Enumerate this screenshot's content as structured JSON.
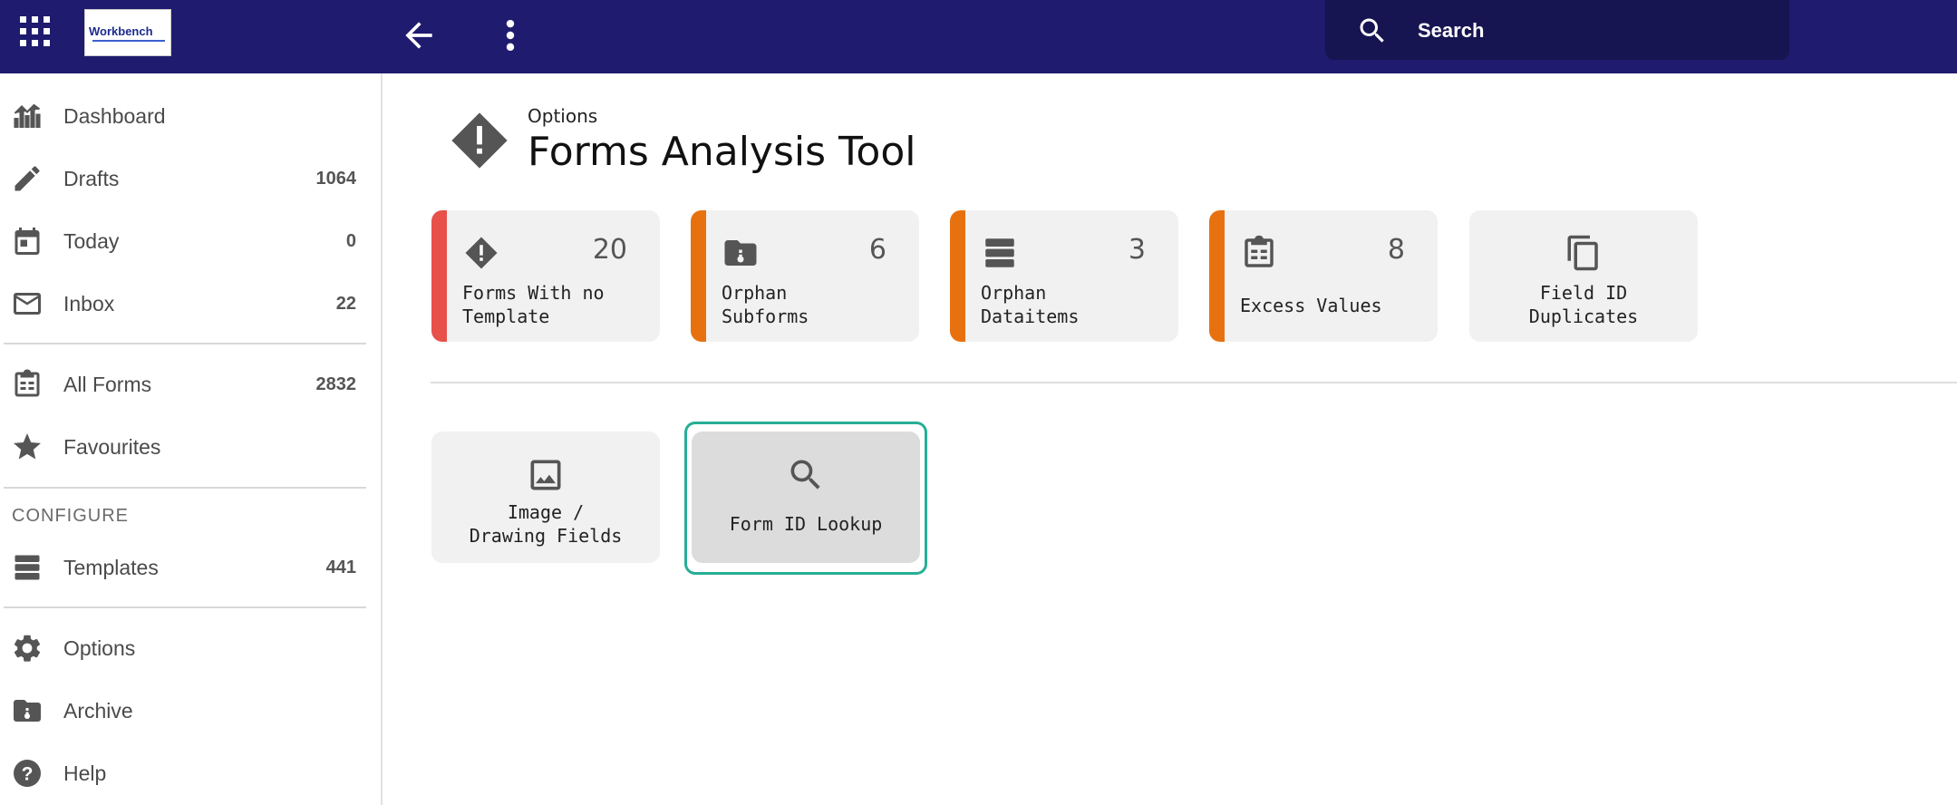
{
  "topbar": {
    "logo_text": "Workbench",
    "search_placeholder": "Search",
    "icons": {
      "apps": "apps-grid-icon",
      "back": "arrow-left-icon",
      "more": "more-vert-icon",
      "search": "search-icon"
    }
  },
  "sidebar": {
    "items": [
      {
        "label": "Dashboard",
        "count": "",
        "icon": "chart-icon"
      },
      {
        "label": "Drafts",
        "count": "1064",
        "icon": "pencil-icon"
      },
      {
        "label": "Today",
        "count": "0",
        "icon": "calendar-icon"
      },
      {
        "label": "Inbox",
        "count": "22",
        "icon": "inbox-icon"
      },
      {
        "label": "All Forms",
        "count": "2832",
        "icon": "clipboard-icon"
      },
      {
        "label": "Favourites",
        "count": "",
        "icon": "star-icon"
      },
      {
        "label": "Templates",
        "count": "441",
        "icon": "stack-icon"
      },
      {
        "label": "Options",
        "count": "",
        "icon": "gear-icon"
      },
      {
        "label": "Archive",
        "count": "",
        "icon": "archive-icon"
      },
      {
        "label": "Help",
        "count": "",
        "icon": "help-icon"
      }
    ],
    "section_configure": "CONFIGURE"
  },
  "main": {
    "breadcrumb": "Options",
    "title": "Forms Analysis Tool",
    "cards": [
      {
        "count": "20",
        "line1": "Forms With no",
        "line2": "Template",
        "icon": "warning-diamond-icon",
        "accent": "#e8504a"
      },
      {
        "count": "6",
        "line1": "Orphan",
        "line2": "Subforms",
        "icon": "folder-lock-icon",
        "accent": "#e8710f"
      },
      {
        "count": "3",
        "line1": "Orphan",
        "line2": "Dataitems",
        "icon": "database-icon",
        "accent": "#e8710f"
      },
      {
        "count": "8",
        "line1": "Excess Values",
        "line2": "",
        "icon": "clipboard-list-icon",
        "accent": "#e8710f"
      },
      {
        "count": "",
        "line1": "Field ID",
        "line2": "Duplicates",
        "icon": "copy-icon",
        "accent": ""
      }
    ],
    "tools": [
      {
        "line1": "Image /",
        "line2": "Drawing Fields",
        "icon": "image-icon"
      },
      {
        "line1": "Form ID Lookup",
        "line2": "",
        "icon": "search-icon"
      }
    ]
  },
  "colors": {
    "topbar": "#1f1b6e",
    "focus": "#27ae96",
    "red_accent": "#e8504a",
    "orange_accent": "#e8710f"
  }
}
